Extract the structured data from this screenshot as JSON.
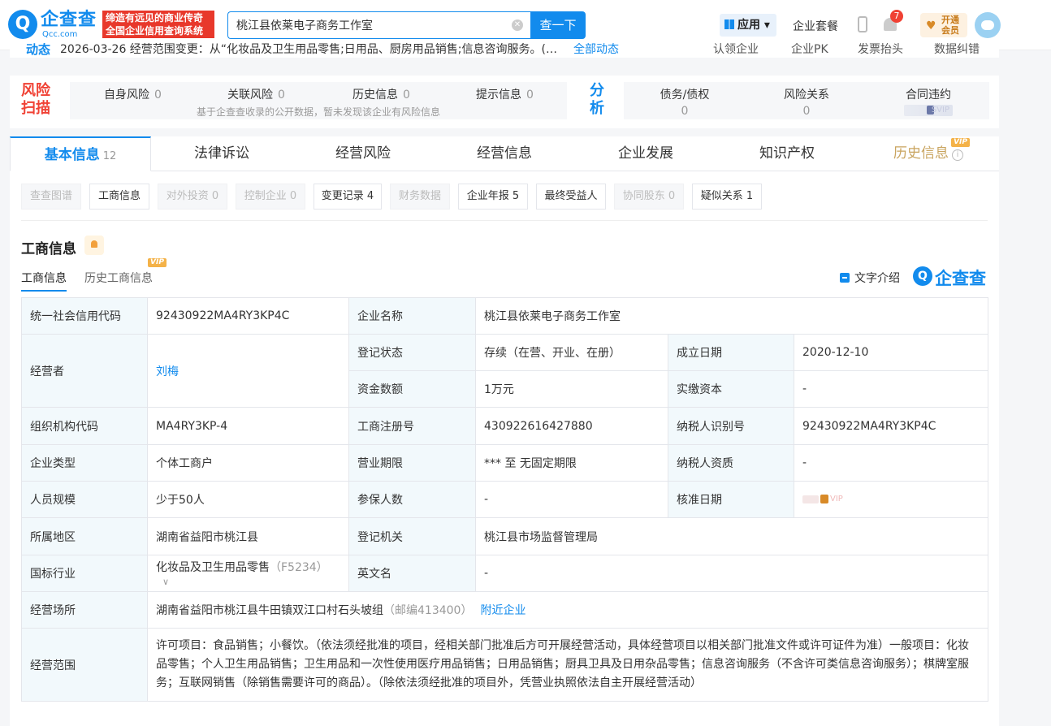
{
  "header": {
    "logo_cn": "企查查",
    "logo_en": "Qcc.com",
    "slogan_line1": "缔造有远见的商业传奇",
    "slogan_line2": "全国企业信用查询系统",
    "search_value": "桃江县依莱电子商务工作室",
    "search_button": "查一下",
    "apps_label": "应用",
    "package_label": "企业套餐",
    "notification_count": "7",
    "vip_line1": "开通",
    "vip_line2": "会员"
  },
  "dynamics": {
    "label": "动态",
    "text": "2026-03-26  经营范围变更：从“化妆品及卫生用品零售;日用品、厨房用品销售;信息咨询服务。(…",
    "more": "全部动态",
    "actions": [
      "认领企业",
      "企业PK",
      "发票抬头",
      "数据纠错"
    ]
  },
  "risk": {
    "title": "风险扫描",
    "items": [
      {
        "label": "自身风险",
        "count": "0"
      },
      {
        "label": "关联风险",
        "count": "0"
      },
      {
        "label": "历史信息",
        "count": "0"
      },
      {
        "label": "提示信息",
        "count": "0"
      }
    ],
    "note": "基于企查查收录的公开数据，暂未发现该企业有风险信息",
    "analysis_title": "分析",
    "analysis": [
      {
        "label": "债务/债权",
        "value": "0"
      },
      {
        "label": "风险关系",
        "value": "0"
      },
      {
        "label": "合同违约",
        "value": ""
      }
    ]
  },
  "tabs": [
    {
      "label": "基本信息",
      "count": "12"
    },
    {
      "label": "法律诉讼",
      "count": ""
    },
    {
      "label": "经营风险",
      "count": ""
    },
    {
      "label": "经营信息",
      "count": ""
    },
    {
      "label": "企业发展",
      "count": ""
    },
    {
      "label": "知识产权",
      "count": ""
    },
    {
      "label": "历史信息",
      "count": ""
    }
  ],
  "vip_tag": "VIP",
  "subtabs": [
    {
      "label": "查查图谱"
    },
    {
      "label": "工商信息"
    },
    {
      "label": "对外投资 0"
    },
    {
      "label": "控制企业 0"
    },
    {
      "label": "变更记录 4"
    },
    {
      "label": "财务数据"
    },
    {
      "label": "企业年报 5"
    },
    {
      "label": "最终受益人"
    },
    {
      "label": "协同股东 0"
    },
    {
      "label": "疑似关系 1"
    }
  ],
  "section": {
    "title": "工商信息",
    "inner_tab1": "工商信息",
    "inner_tab2": "历史工商信息",
    "word_intro": "文字介绍",
    "brand": "企查查"
  },
  "info": {
    "credit_code_k": "统一社会信用代码",
    "credit_code_v": "92430922MA4RY3KP4C",
    "name_k": "企业名称",
    "name_v": "桃江县依莱电子商务工作室",
    "operator_k": "经营者",
    "operator_v": "刘梅",
    "status_k": "登记状态",
    "status_v": "存续（在营、开业、在册）",
    "founded_k": "成立日期",
    "founded_v": "2020-12-10",
    "capital_k": "资金数额",
    "capital_v": "1万元",
    "paid_k": "实缴资本",
    "paid_v": "-",
    "org_k": "组织机构代码",
    "org_v": "MA4RY3KP-4",
    "regno_k": "工商注册号",
    "regno_v": "430922616427880",
    "taxid_k": "纳税人识别号",
    "taxid_v": "92430922MA4RY3KP4C",
    "type_k": "企业类型",
    "type_v": "个体工商户",
    "term_k": "营业期限",
    "term_v": "*** 至 无固定期限",
    "taxq_k": "纳税人资质",
    "taxq_v": "-",
    "staff_k": "人员规模",
    "staff_v": "少于50人",
    "insured_k": "参保人数",
    "insured_v": "-",
    "approve_k": "核准日期",
    "region_k": "所属地区",
    "region_v": "湖南省益阳市桃江县",
    "authority_k": "登记机关",
    "authority_v": "桃江县市场监督管理局",
    "industry_k": "国标行业",
    "industry_v": "化妆品及卫生用品零售",
    "industry_code": "（F5234）",
    "en_k": "英文名",
    "en_v": "-",
    "address_k": "经营场所",
    "address_v": "湖南省益阳市桃江县牛田镇双江口村石头坡组",
    "postcode": "（邮编413400）",
    "nearby": "附近企业",
    "scope_k": "经营范围",
    "scope_v": "许可项目：食品销售；小餐饮。（依法须经批准的项目，经相关部门批准后方可开展经营活动，具体经营项目以相关部门批准文件或许可证件为准）一般项目：化妆品零售；个人卫生用品销售；卫生用品和一次性使用医疗用品销售；日用品销售；厨具卫具及日用杂品零售；信息咨询服务（不含许可类信息咨询服务）；棋牌室服务；互联网销售（除销售需要许可的商品）。（除依法须经批准的项目外，凭营业执照依法自主开展经营活动）"
  }
}
